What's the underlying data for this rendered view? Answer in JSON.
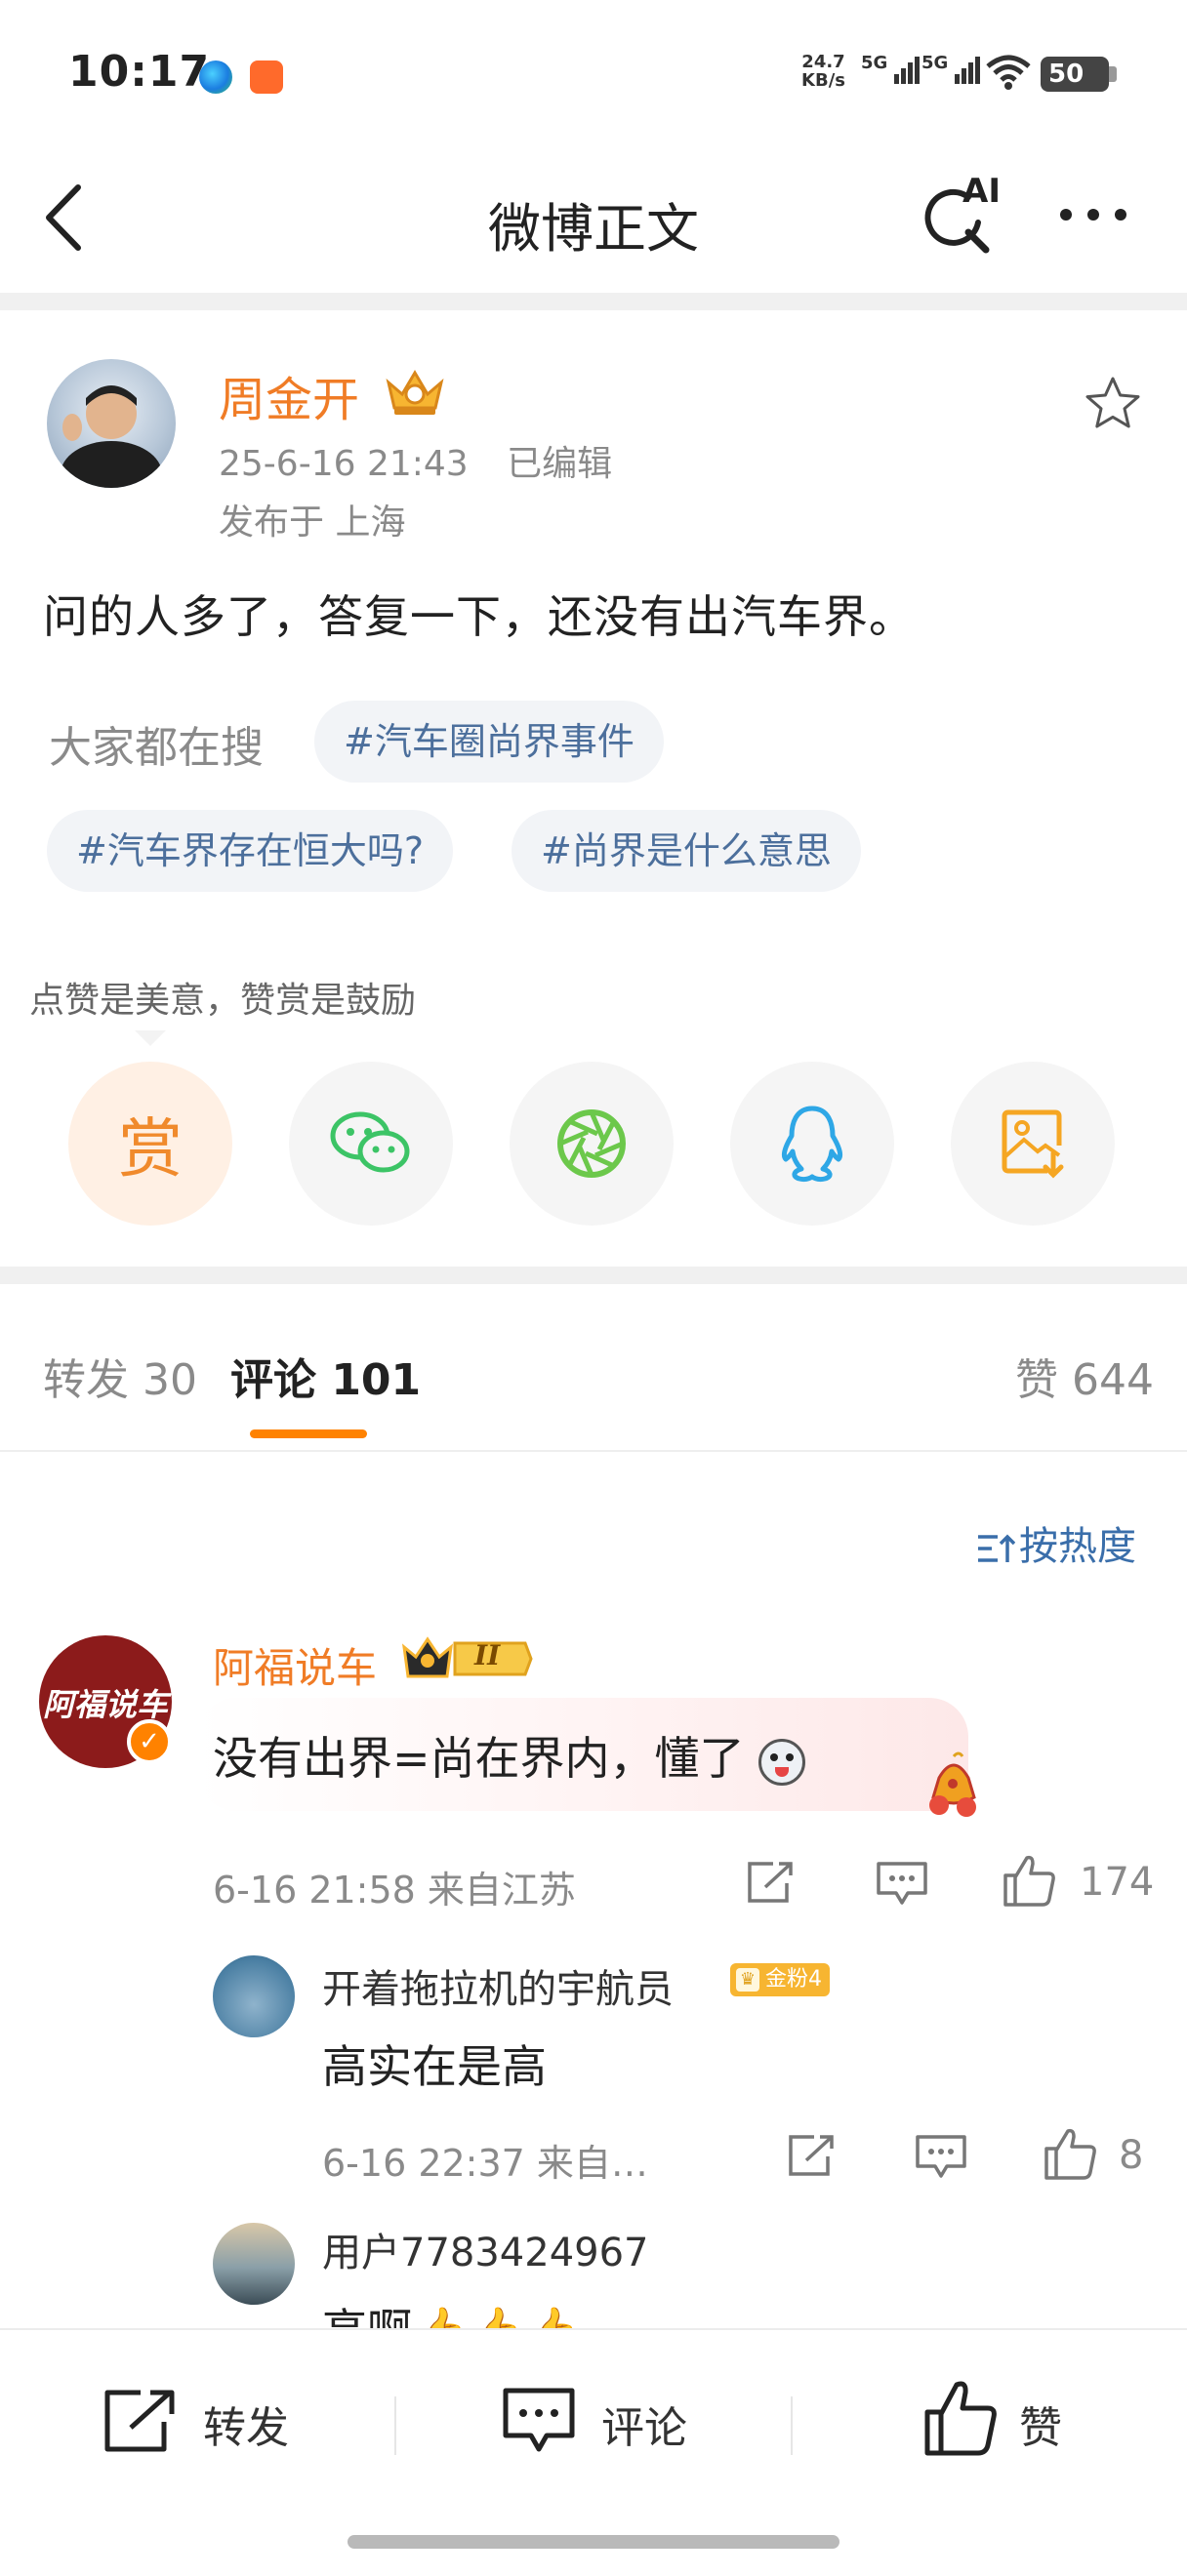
{
  "status_bar": {
    "time": "10:17",
    "net_speed_value": "24.7",
    "net_speed_unit": "KB/s",
    "signal1": "5G",
    "signal2": "5G",
    "battery": "50"
  },
  "nav": {
    "title": "微博正文",
    "ai_label": "AI"
  },
  "post": {
    "author": "周金开",
    "timestamp": "25-6-16 21:43",
    "edited": "已编辑",
    "location": "发布于 上海",
    "text": "问的人多了，答复一下，还没有出汽车界。",
    "hot_label": "大家都在搜",
    "topics": [
      "#汽车圈尚界事件",
      "#汽车界存在恒大吗?",
      "#尚界是什么意思"
    ],
    "tip": "点赞是美意，赞赏是鼓励",
    "reward_label": "赏"
  },
  "tabs": {
    "repost": "转发 30",
    "comment": "评论 101",
    "like": "赞 644"
  },
  "sort_label": "按热度",
  "comments": [
    {
      "user": "阿福说车",
      "avatar_text": "阿福说车",
      "level_badge": "II",
      "text": "没有出界=尚在界内，懂了",
      "time_loc": "6-16 21:58  来自江苏",
      "likes": "174",
      "replies": [
        {
          "user": "开着拖拉机的宇航员",
          "badge": "金粉4",
          "text": "高实在是高",
          "time_loc": "6-16 22:37  来自…",
          "likes": "8"
        },
        {
          "user": "用户7783424967",
          "text": "高啊👍👍👍"
        }
      ]
    }
  ],
  "bottom_bar": {
    "repost": "转发",
    "comment": "评论",
    "like": "赞"
  },
  "colors": {
    "accent_orange": "#ff8200",
    "username_orange": "#f07c26",
    "topic_blue": "#4c6f9c",
    "wechat_green": "#3cc466",
    "moments_green": "#6cc84b",
    "qq_blue": "#2ea7e6",
    "save_orange": "#f5a623"
  }
}
